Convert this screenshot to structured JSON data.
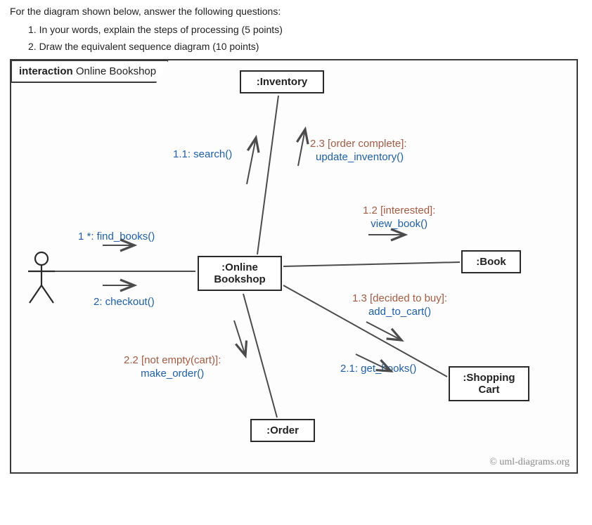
{
  "intro": "For the diagram shown below, answer the following questions:",
  "questions": {
    "q1": "1. In your words, explain the steps of processing (5 points)",
    "q2": "2. Draw the equivalent sequence diagram (10 points)"
  },
  "diagram": {
    "frame_title_keyword": "interaction",
    "frame_title": "Online Bookshop",
    "objects": {
      "inventory": ":Inventory",
      "online_bookshop_line1": ":Online",
      "online_bookshop_line2": "Bookshop",
      "book": ":Book",
      "shopping_cart_line1": ":Shopping",
      "shopping_cart_line2": "Cart",
      "order": ":Order"
    },
    "messages": {
      "m1": "1 *: find_books()",
      "m1_1": "1.1: search()",
      "m1_2_guard": "1.2 [interested]:",
      "m1_2_call": "view_book()",
      "m1_3_guard": "1.3 [decided to buy]:",
      "m1_3_call": "add_to_cart()",
      "m2": "2: checkout()",
      "m2_1": "2.1: get_books()",
      "m2_2_guard": "2.2 [not empty(cart)]:",
      "m2_2_call": "make_order()",
      "m2_3_guard": "2.3 [order complete]:",
      "m2_3_call": "update_inventory()"
    },
    "credit": "© uml-diagrams.org"
  }
}
